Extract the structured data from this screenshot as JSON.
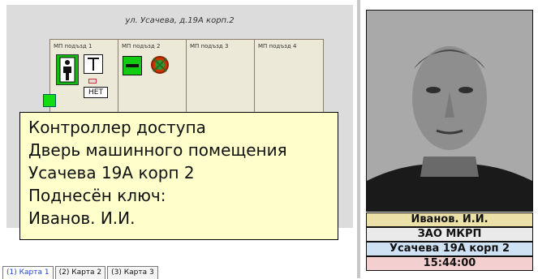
{
  "map": {
    "address": "ул. Усачева, д.19А корп.2",
    "sections": [
      "МП подъзд 1",
      "МП подъзд 2",
      "МП подъзд 3",
      "МП подъзд 4"
    ],
    "net_badge": "НЕТ"
  },
  "tooltip": {
    "lines": [
      "Контроллер доступа",
      "Дверь машинного помещения",
      "Усачева 19А корп 2",
      "Поднесён ключ:",
      "Иванов. И.И."
    ]
  },
  "tabs": [
    "(1) Карта 1",
    "(2) Карта 2",
    "(3) Карта 3"
  ],
  "person": {
    "name": "Иванов. И.И.",
    "company": "ЗАО МКРП",
    "address": "Усачева 19А корп 2",
    "time": "15:44:00"
  },
  "colors": {
    "name_bar": "#eae0a8",
    "company_bar": "#eaeaea",
    "address_bar": "#cfe2f3",
    "time_bar": "#f4cfcf",
    "tooltip_bg": "#ffffcc",
    "status_green": "#11dd11",
    "alarm_red": "#cc3300"
  },
  "icons": [
    "person-passage-icon",
    "turnstile-icon",
    "card-reader-icon",
    "door-icon",
    "alarm-icon",
    "photo-portrait"
  ]
}
